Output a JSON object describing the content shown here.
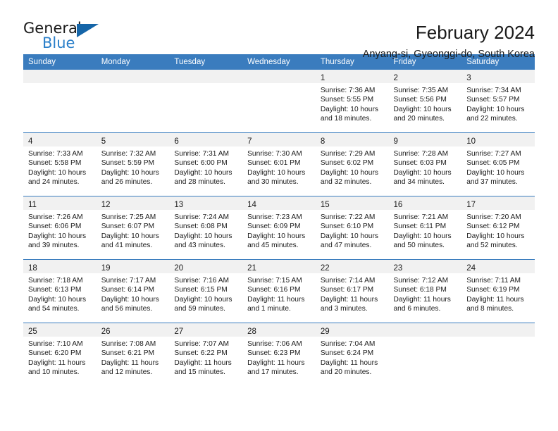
{
  "brand": {
    "name_part1": "General",
    "name_part2": "Blue",
    "logo_icon": "triangle-logo-icon"
  },
  "header": {
    "title": "February 2024",
    "subtitle": "Anyang-si, Gyeonggi-do, South Korea"
  },
  "colors": {
    "header_blue": "#3a7cbe",
    "brand_blue": "#2a7fc9",
    "logo_blue": "#1565a8",
    "daynum_band": "#f1f1f1",
    "text": "#1a1a1a"
  },
  "weekdays": [
    "Sunday",
    "Monday",
    "Tuesday",
    "Wednesday",
    "Thursday",
    "Friday",
    "Saturday"
  ],
  "labels": {
    "sunrise_prefix": "Sunrise:",
    "sunset_prefix": "Sunset:",
    "daylight_prefix": "Daylight:"
  },
  "weeks": [
    [
      {
        "day": "",
        "empty": true
      },
      {
        "day": "",
        "empty": true
      },
      {
        "day": "",
        "empty": true
      },
      {
        "day": "",
        "empty": true
      },
      {
        "day": "1",
        "sunrise": "Sunrise: 7:36 AM",
        "sunset": "Sunset: 5:55 PM",
        "daylight1": "Daylight: 10 hours",
        "daylight2": "and 18 minutes."
      },
      {
        "day": "2",
        "sunrise": "Sunrise: 7:35 AM",
        "sunset": "Sunset: 5:56 PM",
        "daylight1": "Daylight: 10 hours",
        "daylight2": "and 20 minutes."
      },
      {
        "day": "3",
        "sunrise": "Sunrise: 7:34 AM",
        "sunset": "Sunset: 5:57 PM",
        "daylight1": "Daylight: 10 hours",
        "daylight2": "and 22 minutes."
      }
    ],
    [
      {
        "day": "4",
        "sunrise": "Sunrise: 7:33 AM",
        "sunset": "Sunset: 5:58 PM",
        "daylight1": "Daylight: 10 hours",
        "daylight2": "and 24 minutes."
      },
      {
        "day": "5",
        "sunrise": "Sunrise: 7:32 AM",
        "sunset": "Sunset: 5:59 PM",
        "daylight1": "Daylight: 10 hours",
        "daylight2": "and 26 minutes."
      },
      {
        "day": "6",
        "sunrise": "Sunrise: 7:31 AM",
        "sunset": "Sunset: 6:00 PM",
        "daylight1": "Daylight: 10 hours",
        "daylight2": "and 28 minutes."
      },
      {
        "day": "7",
        "sunrise": "Sunrise: 7:30 AM",
        "sunset": "Sunset: 6:01 PM",
        "daylight1": "Daylight: 10 hours",
        "daylight2": "and 30 minutes."
      },
      {
        "day": "8",
        "sunrise": "Sunrise: 7:29 AM",
        "sunset": "Sunset: 6:02 PM",
        "daylight1": "Daylight: 10 hours",
        "daylight2": "and 32 minutes."
      },
      {
        "day": "9",
        "sunrise": "Sunrise: 7:28 AM",
        "sunset": "Sunset: 6:03 PM",
        "daylight1": "Daylight: 10 hours",
        "daylight2": "and 34 minutes."
      },
      {
        "day": "10",
        "sunrise": "Sunrise: 7:27 AM",
        "sunset": "Sunset: 6:05 PM",
        "daylight1": "Daylight: 10 hours",
        "daylight2": "and 37 minutes."
      }
    ],
    [
      {
        "day": "11",
        "sunrise": "Sunrise: 7:26 AM",
        "sunset": "Sunset: 6:06 PM",
        "daylight1": "Daylight: 10 hours",
        "daylight2": "and 39 minutes."
      },
      {
        "day": "12",
        "sunrise": "Sunrise: 7:25 AM",
        "sunset": "Sunset: 6:07 PM",
        "daylight1": "Daylight: 10 hours",
        "daylight2": "and 41 minutes."
      },
      {
        "day": "13",
        "sunrise": "Sunrise: 7:24 AM",
        "sunset": "Sunset: 6:08 PM",
        "daylight1": "Daylight: 10 hours",
        "daylight2": "and 43 minutes."
      },
      {
        "day": "14",
        "sunrise": "Sunrise: 7:23 AM",
        "sunset": "Sunset: 6:09 PM",
        "daylight1": "Daylight: 10 hours",
        "daylight2": "and 45 minutes."
      },
      {
        "day": "15",
        "sunrise": "Sunrise: 7:22 AM",
        "sunset": "Sunset: 6:10 PM",
        "daylight1": "Daylight: 10 hours",
        "daylight2": "and 47 minutes."
      },
      {
        "day": "16",
        "sunrise": "Sunrise: 7:21 AM",
        "sunset": "Sunset: 6:11 PM",
        "daylight1": "Daylight: 10 hours",
        "daylight2": "and 50 minutes."
      },
      {
        "day": "17",
        "sunrise": "Sunrise: 7:20 AM",
        "sunset": "Sunset: 6:12 PM",
        "daylight1": "Daylight: 10 hours",
        "daylight2": "and 52 minutes."
      }
    ],
    [
      {
        "day": "18",
        "sunrise": "Sunrise: 7:18 AM",
        "sunset": "Sunset: 6:13 PM",
        "daylight1": "Daylight: 10 hours",
        "daylight2": "and 54 minutes."
      },
      {
        "day": "19",
        "sunrise": "Sunrise: 7:17 AM",
        "sunset": "Sunset: 6:14 PM",
        "daylight1": "Daylight: 10 hours",
        "daylight2": "and 56 minutes."
      },
      {
        "day": "20",
        "sunrise": "Sunrise: 7:16 AM",
        "sunset": "Sunset: 6:15 PM",
        "daylight1": "Daylight: 10 hours",
        "daylight2": "and 59 minutes."
      },
      {
        "day": "21",
        "sunrise": "Sunrise: 7:15 AM",
        "sunset": "Sunset: 6:16 PM",
        "daylight1": "Daylight: 11 hours",
        "daylight2": "and 1 minute."
      },
      {
        "day": "22",
        "sunrise": "Sunrise: 7:14 AM",
        "sunset": "Sunset: 6:17 PM",
        "daylight1": "Daylight: 11 hours",
        "daylight2": "and 3 minutes."
      },
      {
        "day": "23",
        "sunrise": "Sunrise: 7:12 AM",
        "sunset": "Sunset: 6:18 PM",
        "daylight1": "Daylight: 11 hours",
        "daylight2": "and 6 minutes."
      },
      {
        "day": "24",
        "sunrise": "Sunrise: 7:11 AM",
        "sunset": "Sunset: 6:19 PM",
        "daylight1": "Daylight: 11 hours",
        "daylight2": "and 8 minutes."
      }
    ],
    [
      {
        "day": "25",
        "sunrise": "Sunrise: 7:10 AM",
        "sunset": "Sunset: 6:20 PM",
        "daylight1": "Daylight: 11 hours",
        "daylight2": "and 10 minutes."
      },
      {
        "day": "26",
        "sunrise": "Sunrise: 7:08 AM",
        "sunset": "Sunset: 6:21 PM",
        "daylight1": "Daylight: 11 hours",
        "daylight2": "and 12 minutes."
      },
      {
        "day": "27",
        "sunrise": "Sunrise: 7:07 AM",
        "sunset": "Sunset: 6:22 PM",
        "daylight1": "Daylight: 11 hours",
        "daylight2": "and 15 minutes."
      },
      {
        "day": "28",
        "sunrise": "Sunrise: 7:06 AM",
        "sunset": "Sunset: 6:23 PM",
        "daylight1": "Daylight: 11 hours",
        "daylight2": "and 17 minutes."
      },
      {
        "day": "29",
        "sunrise": "Sunrise: 7:04 AM",
        "sunset": "Sunset: 6:24 PM",
        "daylight1": "Daylight: 11 hours",
        "daylight2": "and 20 minutes."
      },
      {
        "day": "",
        "empty": true
      },
      {
        "day": "",
        "empty": true
      }
    ]
  ]
}
